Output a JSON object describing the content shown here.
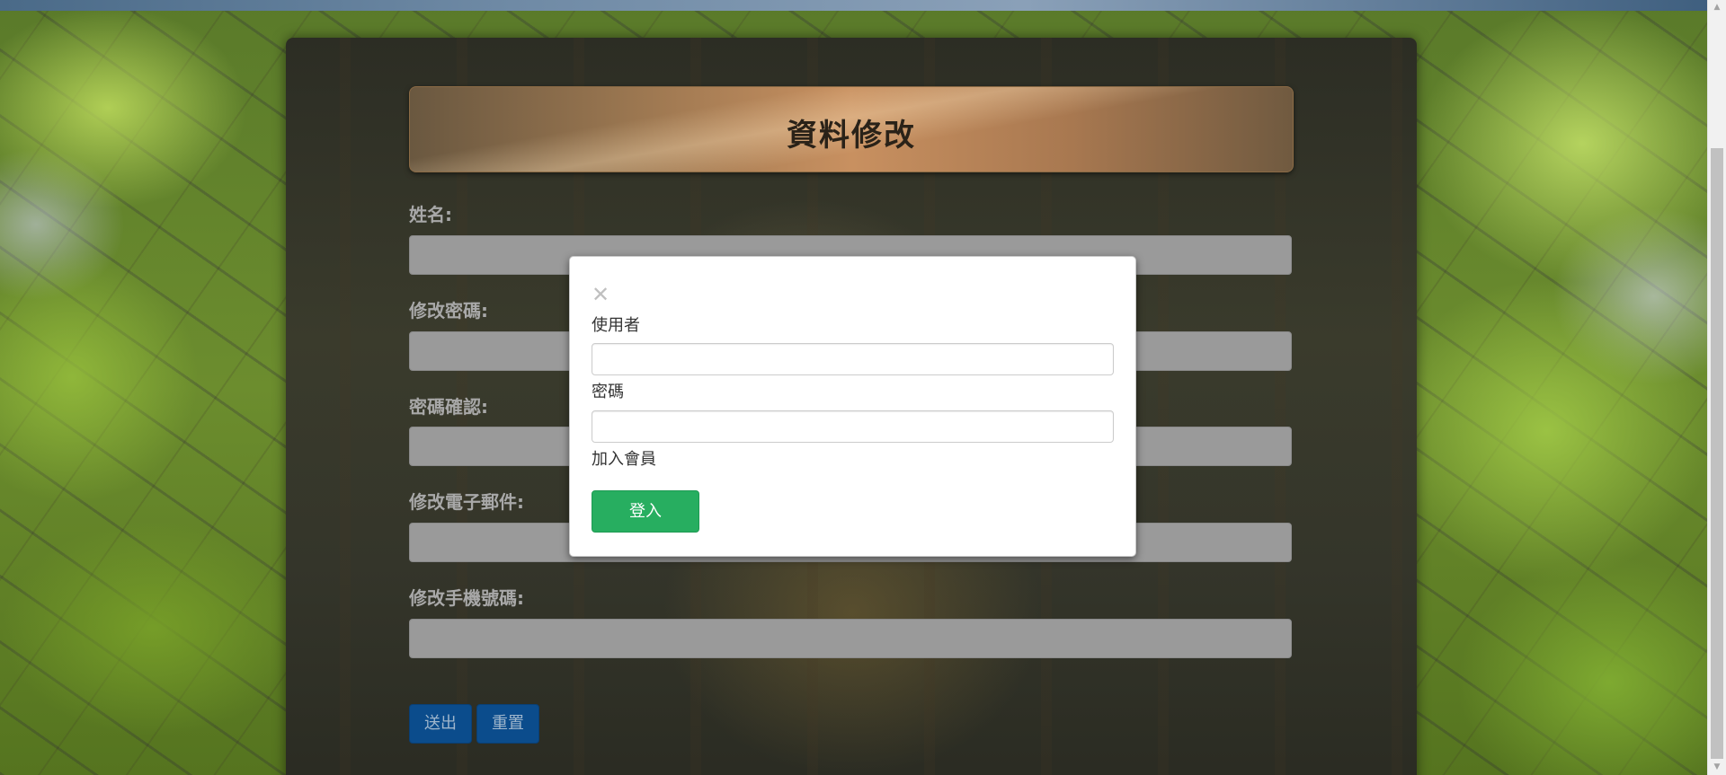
{
  "form": {
    "title": "資料修改",
    "fields": [
      {
        "label": "姓名:"
      },
      {
        "label": "修改密碼:"
      },
      {
        "label": "密碼確認:"
      },
      {
        "label": "修改電子郵件:"
      },
      {
        "label": "修改手機號碼:"
      }
    ],
    "submit_label": "送出",
    "reset_label": "重置"
  },
  "modal": {
    "close_glyph": "✕",
    "username_label": "使用者",
    "username_value": "",
    "password_label": "密碼",
    "password_value": "",
    "register_link": "加入會員",
    "login_label": "登入"
  },
  "colors": {
    "login_button": "#27ae60",
    "action_buttons": "#0b4c8c",
    "title_banner": "#c89060"
  },
  "icons": {
    "close": "close-icon",
    "scroll_up": "scroll-up-arrow-icon",
    "scroll_down": "scroll-down-arrow-icon"
  }
}
